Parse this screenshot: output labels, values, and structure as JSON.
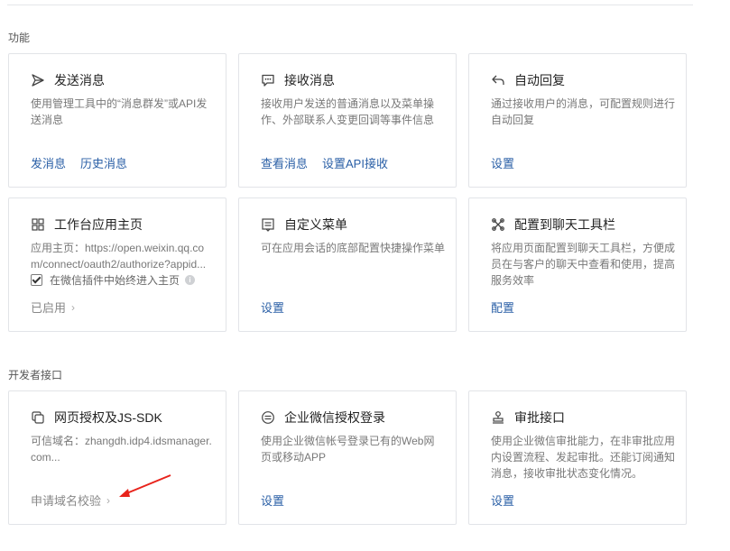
{
  "sections": {
    "features_title": "功能",
    "dev_title": "开发者接口"
  },
  "cards": [
    {
      "title": "发送消息",
      "desc": "使用管理工具中的“消息群发”或API发送消息",
      "actions": [
        "发消息",
        "历史消息"
      ],
      "icon": "send-icon"
    },
    {
      "title": "接收消息",
      "desc": "接收用户发送的普通消息以及菜单操作、外部联系人变更回调等事件信息",
      "actions": [
        "查看消息",
        "设置API接收"
      ],
      "icon": "chat-bubble-icon"
    },
    {
      "title": "自动回复",
      "desc": "通过接收用户的消息，可配置规则进行自动回复",
      "actions": [
        "设置"
      ],
      "icon": "reply-icon"
    },
    {
      "title": "工作台应用主页",
      "desc": "应用主页：https://open.weixin.qq.com/connect/oauth2/authorize?appid...",
      "checkbox_label": "在微信插件中始终进入主页",
      "status": "已启用",
      "icon": "grid-icon"
    },
    {
      "title": "自定义菜单",
      "desc": "可在应用会话的底部配置快捷操作菜单",
      "actions": [
        "设置"
      ],
      "icon": "menu-icon"
    },
    {
      "title": "配置到聊天工具栏",
      "desc": "将应用页面配置到聊天工具栏，方便成员在与客户的聊天中查看和使用，提高服务效率",
      "actions": [
        "配置"
      ],
      "icon": "tools-icon"
    },
    {
      "title": "网页授权及JS-SDK",
      "desc": "可信域名：zhangdh.idp4.idsmanager.com...",
      "status": "申请域名校验",
      "icon": "copy-icon"
    },
    {
      "title": "企业微信授权登录",
      "desc": "使用企业微信帐号登录已有的Web网页或移动APP",
      "actions": [
        "设置"
      ],
      "icon": "login-icon"
    },
    {
      "title": "审批接口",
      "desc": "使用企业微信审批能力，在非审批应用内设置流程、发起审批。还能订阅通知消息，接收审批状态变化情况。",
      "actions": [
        "设置"
      ],
      "icon": "stamp-icon"
    }
  ],
  "colors": {
    "link": "#2a5fa6",
    "border": "#e2e4e8",
    "arrow": "#e8231b"
  }
}
